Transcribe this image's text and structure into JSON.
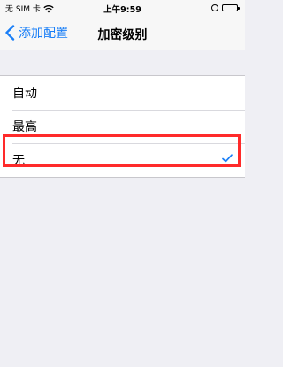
{
  "status_bar": {
    "carrier": "无 SIM 卡",
    "time": "上午9:59"
  },
  "nav": {
    "back_label": "添加配置",
    "title": "加密级别",
    "accent_color": "#1a7ff7"
  },
  "options": [
    {
      "label": "自动",
      "selected": false
    },
    {
      "label": "最高",
      "selected": false
    },
    {
      "label": "无",
      "selected": true
    }
  ],
  "highlight_color": "#ff2a2a"
}
